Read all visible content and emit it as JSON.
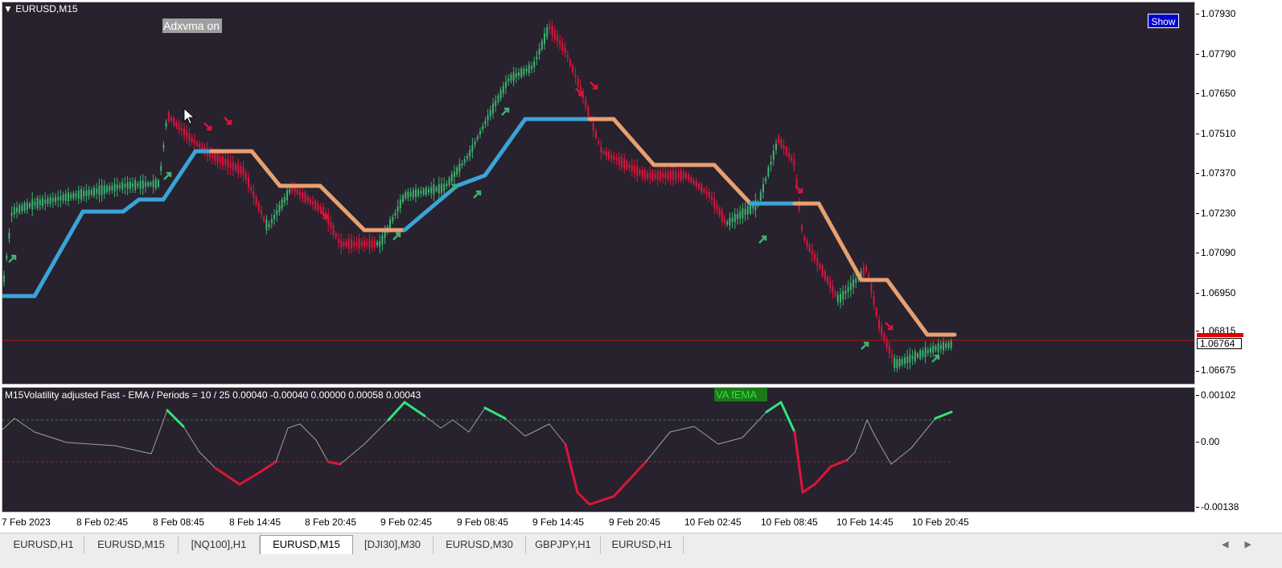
{
  "window": {
    "symbol_label": "EURUSD,M15",
    "show_button": "Show",
    "adx_label": "Adxvma on"
  },
  "price_axis": {
    "ticks": [
      "1.07930",
      "1.07790",
      "1.07650",
      "1.07510",
      "1.07370",
      "1.07230",
      "1.07090",
      "1.06950",
      "1.06815",
      "1.06675"
    ],
    "current_price": "1.06764"
  },
  "indicator": {
    "title": "M15Volatility adjusted Fast - EMA / Periods = 10 / 25  0.00040 -0.00040 0.00000 0.00058 0.00043",
    "badge": "VA fEMA",
    "axis_ticks": [
      "0.00102",
      "0.00",
      "-0.00138"
    ]
  },
  "time_axis": {
    "labels": [
      "7 Feb 2023",
      "8 Feb 02:45",
      "8 Feb 08:45",
      "8 Feb 14:45",
      "8 Feb 20:45",
      "9 Feb 02:45",
      "9 Feb 08:45",
      "9 Feb 14:45",
      "9 Feb 20:45",
      "10 Feb 02:45",
      "10 Feb 08:45",
      "10 Feb 14:45",
      "10 Feb 20:45"
    ]
  },
  "tabs": [
    {
      "label": "EURUSD,H1",
      "active": false
    },
    {
      "label": "EURUSD,M15",
      "active": false
    },
    {
      "label": "[NQ100],H1",
      "active": false
    },
    {
      "label": "EURUSD,M15",
      "active": true
    },
    {
      "label": "[DJI30],M30",
      "active": false
    },
    {
      "label": "EURUSD,M30",
      "active": false
    },
    {
      "label": "GBPJPY,H1",
      "active": false
    },
    {
      "label": "EURUSD,H1",
      "active": false
    }
  ],
  "colors": {
    "background": "#27222d",
    "bull_candle": "#3cb371",
    "bear_candle": "#dc143c",
    "adxvma_up": "#3ba3d8",
    "adxvma_down": "#e8a070",
    "osc_up": "#33e37a",
    "osc_down": "#dc143c",
    "osc_neutral": "#a0a0a0"
  }
}
